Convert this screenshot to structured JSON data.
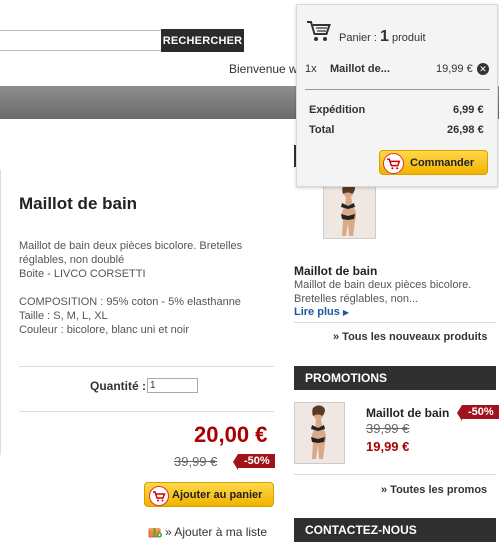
{
  "header": {
    "search_value": "",
    "search_button": "RECHERCHER",
    "welcome": "Bienvenue w"
  },
  "cart_popup": {
    "panier_label": "Panier :",
    "count": "1",
    "count_unit": "produit",
    "item_qty": "1x",
    "item_name": "Maillot de...",
    "item_price": "19,99 €",
    "shipping_label": "Expédition",
    "shipping_value": "6,99 €",
    "total_label": "Total",
    "total_value": "26,98 €",
    "order_button": "Commander"
  },
  "product": {
    "title": "Maillot de bain",
    "desc_lines": [
      "Maillot de bain deux pièces bicolore. Bretelles",
      "réglables, non doublé",
      "Boite - LIVCO CORSETTI",
      "",
      "COMPOSITION : 95% coton - 5% elasthanne",
      "Taille : S, M, L, XL",
      "Couleur : bicolore, blanc uni et noir"
    ],
    "quantity_label": "Quantité :",
    "quantity_value": "1",
    "price": "20,00 €",
    "old_price": "39,99 €",
    "discount": "-50%",
    "add_to_cart": "Ajouter au panier",
    "wishlist": "» Ajouter à ma liste"
  },
  "new_products": {
    "name": "Maillot de bain",
    "desc_line1": "Maillot de bain deux pièces bicolore.",
    "desc_line2": "Bretelles réglables, non...",
    "more": "Lire plus",
    "all_link": "» Tous les nouveaux produits"
  },
  "promotions": {
    "heading": "PROMOTIONS",
    "name": "Maillot de bain",
    "discount": "-50%",
    "old_price": "39,99 €",
    "price": "19,99 €",
    "all_link": "» Toutes les promos"
  },
  "contact": {
    "heading": "CONTACTEZ-NOUS"
  },
  "colors": {
    "accent_red": "#a1131a",
    "price_red": "#aa0000",
    "button_yellow": "#f2b300",
    "dark_header": "#2f2f2f",
    "link_blue": "#1a5aa0"
  }
}
